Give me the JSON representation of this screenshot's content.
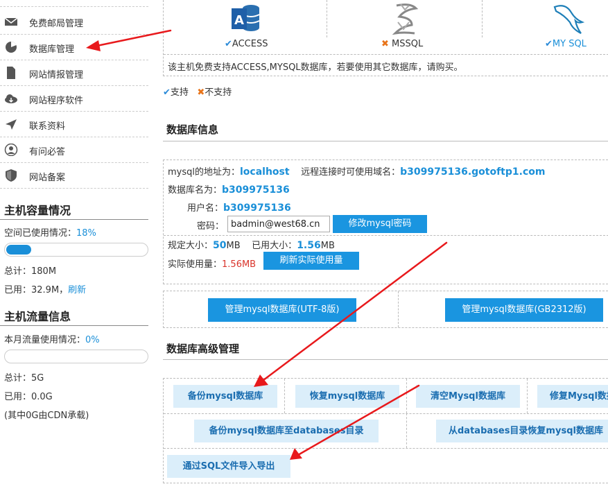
{
  "sidebar": {
    "items": [
      {
        "label": "免费邮局管理",
        "icon": "mail-icon"
      },
      {
        "label": "数据库管理",
        "icon": "pie-chart-icon"
      },
      {
        "label": "网站情报管理",
        "icon": "document-icon"
      },
      {
        "label": "网站程序软件",
        "icon": "cloud-download-icon"
      },
      {
        "label": "联系资料",
        "icon": "paper-plane-icon"
      },
      {
        "label": "有问必答",
        "icon": "user-icon"
      },
      {
        "label": "网站备案",
        "icon": "shield-icon"
      }
    ],
    "capacity": {
      "title": "主机容量情况",
      "usage_label": "空间已使用情况：",
      "usage_value": "18%",
      "usage_fraction": 0.18,
      "total": "总计：180M",
      "used_label": "已用：32.9M，",
      "refresh": "刷新"
    },
    "traffic": {
      "title": "主机流量信息",
      "usage_label": "本月流量使用情况：",
      "usage_value": "0%",
      "usage_fraction": 0.0,
      "total": "总计：5G",
      "used": "已用：0.0G",
      "cdn_note": "(其中0G由CDN承载)"
    }
  },
  "db_types": [
    {
      "name": "ACCESS",
      "status": "✔",
      "supported": true,
      "icon": "access-logo-icon"
    },
    {
      "name": "MSSQL",
      "status": "✖",
      "supported": false,
      "icon": "sqlserver-logo-icon"
    },
    {
      "name": "MY SQL",
      "status": "✔",
      "supported": true,
      "icon": "mysql-dolphin-icon"
    }
  ],
  "support_note": "该主机免费支持ACCESS,MYSQL数据库，若要使用其它数据库，请购买。",
  "legend": {
    "check": "✔",
    "supported": "支持",
    "cross": "✖",
    "unsupported": "不支持"
  },
  "db_info": {
    "title": "数据库信息",
    "address_label": "mysql的地址为：",
    "address": "localhost",
    "remote_label": "远程连接时可使用域名：",
    "remote_domain": "b309975136.gotoftp1.com",
    "dbname_label": "数据库名为：",
    "dbname": "b309975136",
    "username_label": "用户名：",
    "username": "b309975136",
    "password_label": "密码：",
    "password": "badmin@west68.cn",
    "change_pw_button": "修改mysql密码",
    "quota_label": "规定大小：",
    "quota_value": "50",
    "quota_unit": "MB",
    "used_label": "已用大小：",
    "used_value": "1.56",
    "used_unit": "MB",
    "actual_label": "实际使用量：",
    "actual_value": "1.56MB",
    "refresh_button": "刷新实际使用量",
    "manage_utf8_button": "管理mysql数据库(UTF-8版)",
    "manage_gb_button": "管理mysql数据库(GB2312版)"
  },
  "advanced": {
    "title": "数据库高级管理",
    "backup": "备份mysql数据库",
    "restore": "恢复mysql数据库",
    "clear": "清空Mysql数据库",
    "repair": "修复Mysql数据库",
    "backup_dir": "备份mysql数据库至databases目录",
    "restore_dir": "从databases目录恢复mysql数据库",
    "sql_import": "通过SQL文件导入导出"
  },
  "colors": {
    "accent": "#1a95e0",
    "annotation_arrow": "#e8191c",
    "light_button": "#dbeefa"
  }
}
